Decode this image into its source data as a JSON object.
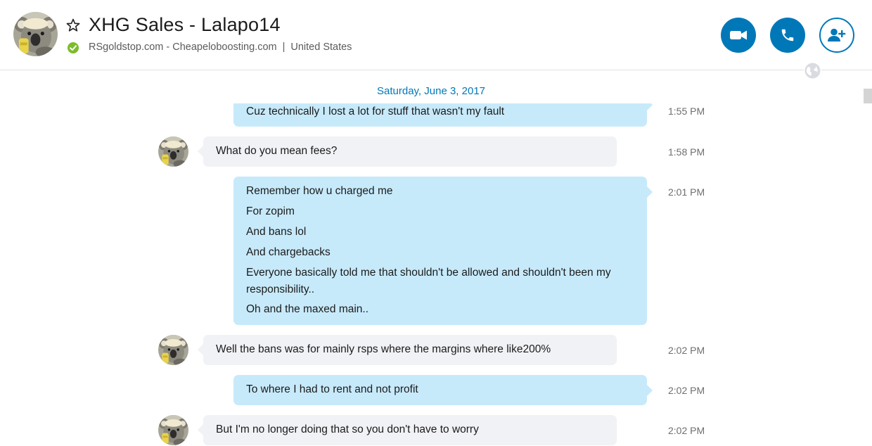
{
  "header": {
    "title": "XHG Sales - Lalapo14",
    "status_color": "#7dbc2b",
    "subtitle_mood": "RSgoldstop.com - Cheapeloboosting.com",
    "subtitle_separator": "|",
    "subtitle_location": "United States",
    "accent": "#0078b8",
    "buttons": [
      {
        "icon": "video-camera-icon",
        "label": "Video call"
      },
      {
        "icon": "phone-icon",
        "label": "Call"
      },
      {
        "icon": "add-contact-icon",
        "label": "Add people"
      }
    ]
  },
  "conversation": {
    "date_header": "Saturday, June 3, 2017",
    "messages": [
      {
        "direction": "out",
        "lines": [
          "Cuz technically I lost a lot for stuff that wasn't my fault"
        ],
        "time": "1:55 PM"
      },
      {
        "direction": "in",
        "lines": [
          "What do you mean fees?"
        ],
        "time": "1:58 PM"
      },
      {
        "direction": "out",
        "lines": [
          "Remember how u charged me",
          "For zopim",
          "And bans lol",
          "And chargebacks",
          "Everyone basically told me that shouldn't be allowed and shouldn't been my",
          "responsibility..",
          "Oh and the maxed main.."
        ],
        "time": "2:01 PM"
      },
      {
        "direction": "in",
        "lines": [
          "Well the bans was for mainly rsps where the margins where like200%"
        ],
        "time": "2:02 PM"
      },
      {
        "direction": "out",
        "lines": [
          "To where I had to rent and not profit"
        ],
        "time": "2:02 PM"
      },
      {
        "direction": "in",
        "lines": [
          "But I'm no longer doing that so you don't have to worry"
        ],
        "time": "2:02 PM"
      }
    ]
  }
}
